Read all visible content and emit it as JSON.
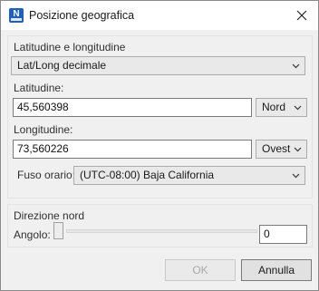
{
  "window": {
    "title": "Posizione geografica",
    "app_icon_letter": "N",
    "close_icon": "close-icon"
  },
  "coords_group": {
    "title": "Latitudine e longitudine",
    "format_select": "Lat/Long decimale",
    "latitude_label": "Latitudine:",
    "latitude_value": "45,560398",
    "latitude_hemisphere": "Nord",
    "longitude_label": "Longitudine:",
    "longitude_value": "73,560226",
    "longitude_hemisphere": "Ovest",
    "timezone_label": "Fuso orario:",
    "timezone_value": "(UTC-08:00) Baja California"
  },
  "north_group": {
    "title": "Direzione nord",
    "angle_label": "Angolo:",
    "angle_value": "0"
  },
  "buttons": {
    "ok": "OK",
    "cancel": "Annulla"
  },
  "colors": {
    "app_icon": "#1f5fbf",
    "dialog_bg": "#f0f0f0"
  }
}
